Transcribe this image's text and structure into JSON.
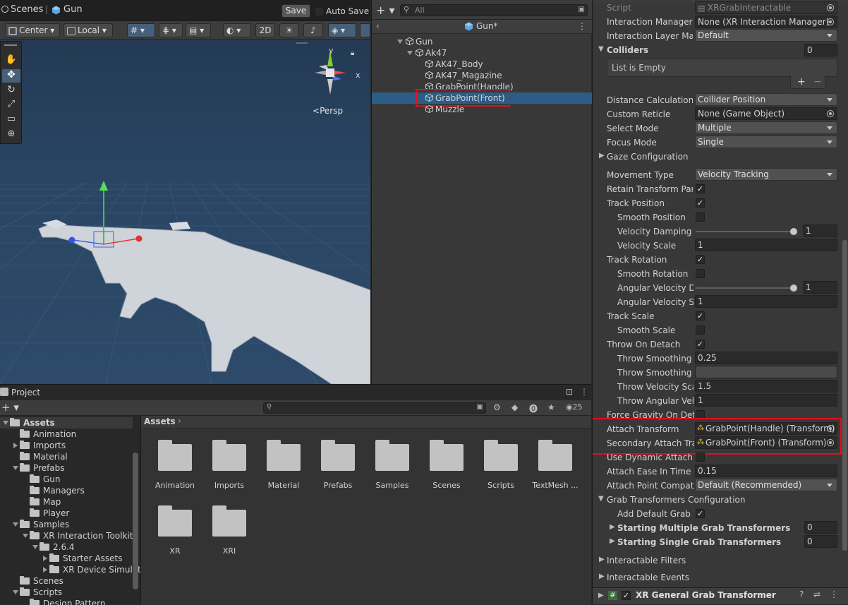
{
  "scene": {
    "tab_scenes": "Scenes",
    "tab_gun": "Gun",
    "save_label": "Save",
    "autosave_label": "Auto Save",
    "pivot_center": "Center",
    "pivot_local": "Local",
    "mode_2d": "2D",
    "persp_label": "Persp",
    "axis_y": "y",
    "axis_x": "x"
  },
  "hierarchy": {
    "search_placeholder": "All",
    "title": "Gun*",
    "items": [
      {
        "label": "Gun",
        "depth": 0,
        "expanded": true
      },
      {
        "label": "Ak47",
        "depth": 1,
        "expanded": true
      },
      {
        "label": "AK47_Body",
        "depth": 2
      },
      {
        "label": "AK47_Magazine",
        "depth": 2
      },
      {
        "label": "GrabPoint(Handle)",
        "depth": 2
      },
      {
        "label": "GrabPoint(Front)",
        "depth": 2,
        "selected": true
      },
      {
        "label": "Muzzle",
        "depth": 2
      }
    ]
  },
  "project": {
    "tab_label": "Project",
    "hidden_count": "25",
    "breadcrumb": "Assets",
    "tree": [
      {
        "label": "Assets",
        "depth": 0,
        "arrow": "down",
        "bold": true
      },
      {
        "label": "Animation",
        "depth": 1,
        "arrow": "none"
      },
      {
        "label": "Imports",
        "depth": 1,
        "arrow": "right"
      },
      {
        "label": "Material",
        "depth": 1,
        "arrow": "none"
      },
      {
        "label": "Prefabs",
        "depth": 1,
        "arrow": "down"
      },
      {
        "label": "Gun",
        "depth": 2,
        "arrow": "none"
      },
      {
        "label": "Managers",
        "depth": 2,
        "arrow": "none"
      },
      {
        "label": "Map",
        "depth": 2,
        "arrow": "none"
      },
      {
        "label": "Player",
        "depth": 2,
        "arrow": "none"
      },
      {
        "label": "Samples",
        "depth": 1,
        "arrow": "down"
      },
      {
        "label": "XR Interaction Toolkit",
        "depth": 2,
        "arrow": "down"
      },
      {
        "label": "2.6.4",
        "depth": 3,
        "arrow": "down"
      },
      {
        "label": "Starter Assets",
        "depth": 4,
        "arrow": "right"
      },
      {
        "label": "XR Device Simulator",
        "depth": 4,
        "arrow": "right"
      },
      {
        "label": "Scenes",
        "depth": 1,
        "arrow": "none"
      },
      {
        "label": "Scripts",
        "depth": 1,
        "arrow": "down"
      },
      {
        "label": "Design Pattern",
        "depth": 2,
        "arrow": "none"
      }
    ],
    "folders": [
      "Animation",
      "Imports",
      "Material",
      "Prefabs",
      "Samples",
      "Scenes",
      "Scripts",
      "TextMesh ...",
      "XR",
      "XRI"
    ]
  },
  "inspector": {
    "script_label": "Script",
    "script_value": "XRGrabInteractable",
    "interaction_manager_label": "Interaction Manager",
    "interaction_manager_value": "None (XR Interaction Manager)",
    "interaction_layer_label": "Interaction Layer Mask",
    "interaction_layer_value": "Default",
    "colliders_label": "Colliders",
    "colliders_count": "0",
    "colliders_empty": "List is Empty",
    "distance_calc_label": "Distance Calculation Mode",
    "distance_calc_value": "Collider Position",
    "custom_reticle_label": "Custom Reticle",
    "custom_reticle_value": "None (Game Object)",
    "select_mode_label": "Select Mode",
    "select_mode_value": "Multiple",
    "focus_mode_label": "Focus Mode",
    "focus_mode_value": "Single",
    "gaze_config_label": "Gaze Configuration",
    "movement_type_label": "Movement Type",
    "movement_type_value": "Velocity Tracking",
    "retain_parent_label": "Retain Transform Parent",
    "track_position_label": "Track Position",
    "smooth_position_label": "Smooth Position",
    "velocity_damping_label": "Velocity Damping",
    "velocity_damping_value": "1",
    "velocity_scale_label": "Velocity Scale",
    "velocity_scale_value": "1",
    "track_rotation_label": "Track Rotation",
    "smooth_rotation_label": "Smooth Rotation",
    "angular_damping_label": "Angular Velocity Damping",
    "angular_damping_value": "1",
    "angular_scale_label": "Angular Velocity Scale",
    "angular_scale_value": "1",
    "track_scale_label": "Track Scale",
    "smooth_scale_label": "Smooth Scale",
    "throw_on_detach_label": "Throw On Detach",
    "throw_smoothing_duration_label": "Throw Smoothing Duration",
    "throw_smoothing_duration_value": "0.25",
    "throw_smoothing_curve_label": "Throw Smoothing Curve",
    "throw_velocity_scale_label": "Throw Velocity Scale",
    "throw_velocity_scale_value": "1.5",
    "throw_angular_scale_label": "Throw Angular Velocity Scale",
    "throw_angular_scale_value": "1",
    "force_gravity_label": "Force Gravity On Detach",
    "attach_transform_label": "Attach Transform",
    "attach_transform_value": "GrabPoint(Handle) (Transform)",
    "secondary_attach_label": "Secondary Attach Transform",
    "secondary_attach_value": "GrabPoint(Front) (Transform)",
    "use_dynamic_attach_label": "Use Dynamic Attach",
    "attach_ease_label": "Attach Ease In Time",
    "attach_ease_value": "0.15",
    "attach_compat_label": "Attach Point Compatibility Mode",
    "attach_compat_value": "Default (Recommended)",
    "grab_transformers_label": "Grab Transformers Configuration",
    "add_default_label": "Add Default Grab Transformers",
    "starting_multiple_label": "Starting Multiple Grab Transformers",
    "starting_multiple_value": "0",
    "starting_single_label": "Starting Single Grab Transformers",
    "starting_single_value": "0",
    "interactable_filters_label": "Interactable Filters",
    "interactable_events_label": "Interactable Events",
    "component_title": "XR General Grab Transformer"
  },
  "colors": {
    "accent_blue": "#2c5d87",
    "highlight_red": "#e0101c",
    "viewport_sky": "#273c54"
  }
}
